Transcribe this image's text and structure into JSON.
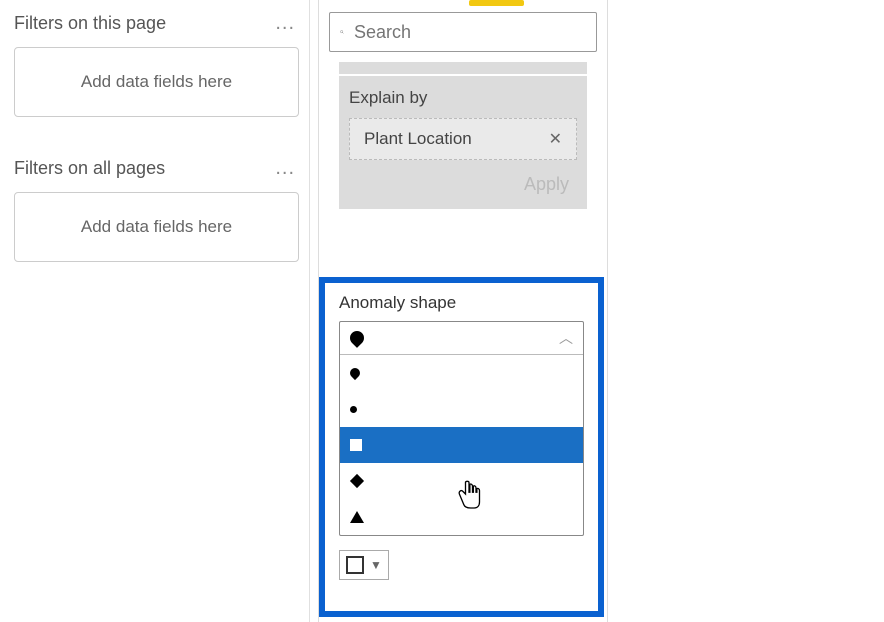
{
  "filters": {
    "page_title": "Filters on this page",
    "all_title": "Filters on all pages",
    "well_placeholder": "Add data fields here",
    "ellipsis": "..."
  },
  "search": {
    "placeholder": "Search"
  },
  "explain": {
    "label": "Explain by",
    "chip": "Plant Location",
    "apply": "Apply"
  },
  "anomaly": {
    "title": "Anomaly shape",
    "options": {
      "drop": "drop",
      "drop_small": "drop-small",
      "dot": "dot",
      "square": "square",
      "diamond": "diamond",
      "triangle": "triangle"
    },
    "selected": "square"
  },
  "colors": {
    "accent": "#f2c811",
    "highlight": "#0a61d0",
    "selected_row": "#1a6fc4"
  }
}
